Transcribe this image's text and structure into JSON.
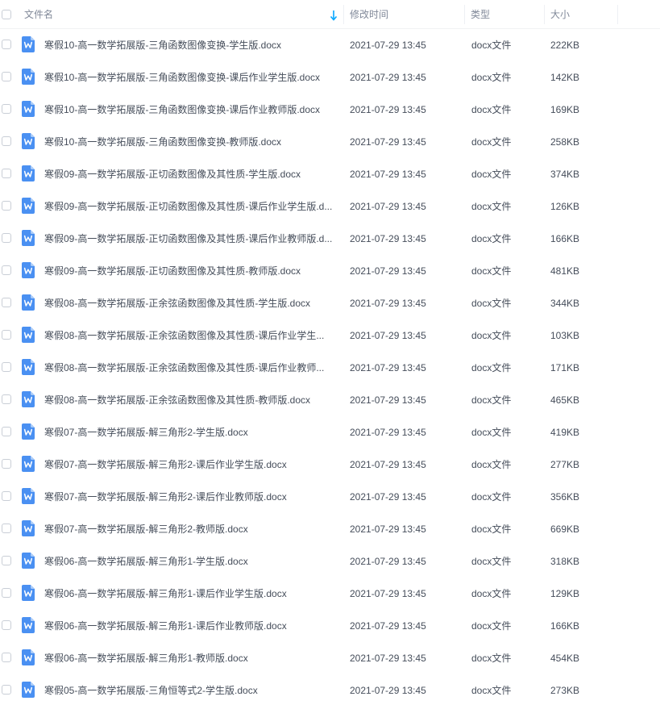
{
  "header": {
    "name_label": "文件名",
    "time_label": "修改时间",
    "type_label": "类型",
    "size_label": "大小"
  },
  "colors": {
    "accent": "#06a7ff",
    "doc_icon": "#4a90f2",
    "text": "#454d5a",
    "header_text": "#818999"
  },
  "icons": {
    "file": "word-doc-icon",
    "sort": "arrow-down-icon"
  },
  "files": [
    {
      "name": "寒假10-高一数学拓展版-三角函数图像变换-学生版.docx",
      "time": "2021-07-29 13:45",
      "type": "docx文件",
      "size": "222KB"
    },
    {
      "name": "寒假10-高一数学拓展版-三角函数图像变换-课后作业学生版.docx",
      "time": "2021-07-29 13:45",
      "type": "docx文件",
      "size": "142KB"
    },
    {
      "name": "寒假10-高一数学拓展版-三角函数图像变换-课后作业教师版.docx",
      "time": "2021-07-29 13:45",
      "type": "docx文件",
      "size": "169KB"
    },
    {
      "name": "寒假10-高一数学拓展版-三角函数图像变换-教师版.docx",
      "time": "2021-07-29 13:45",
      "type": "docx文件",
      "size": "258KB"
    },
    {
      "name": "寒假09-高一数学拓展版-正切函数图像及其性质-学生版.docx",
      "time": "2021-07-29 13:45",
      "type": "docx文件",
      "size": "374KB"
    },
    {
      "name": "寒假09-高一数学拓展版-正切函数图像及其性质-课后作业学生版.d...",
      "time": "2021-07-29 13:45",
      "type": "docx文件",
      "size": "126KB"
    },
    {
      "name": "寒假09-高一数学拓展版-正切函数图像及其性质-课后作业教师版.d...",
      "time": "2021-07-29 13:45",
      "type": "docx文件",
      "size": "166KB"
    },
    {
      "name": "寒假09-高一数学拓展版-正切函数图像及其性质-教师版.docx",
      "time": "2021-07-29 13:45",
      "type": "docx文件",
      "size": "481KB"
    },
    {
      "name": "寒假08-高一数学拓展版-正余弦函数图像及其性质-学生版.docx",
      "time": "2021-07-29 13:45",
      "type": "docx文件",
      "size": "344KB"
    },
    {
      "name": "寒假08-高一数学拓展版-正余弦函数图像及其性质-课后作业学生...",
      "time": "2021-07-29 13:45",
      "type": "docx文件",
      "size": "103KB"
    },
    {
      "name": "寒假08-高一数学拓展版-正余弦函数图像及其性质-课后作业教师...",
      "time": "2021-07-29 13:45",
      "type": "docx文件",
      "size": "171KB"
    },
    {
      "name": "寒假08-高一数学拓展版-正余弦函数图像及其性质-教师版.docx",
      "time": "2021-07-29 13:45",
      "type": "docx文件",
      "size": "465KB"
    },
    {
      "name": "寒假07-高一数学拓展版-解三角形2-学生版.docx",
      "time": "2021-07-29 13:45",
      "type": "docx文件",
      "size": "419KB"
    },
    {
      "name": "寒假07-高一数学拓展版-解三角形2-课后作业学生版.docx",
      "time": "2021-07-29 13:45",
      "type": "docx文件",
      "size": "277KB"
    },
    {
      "name": "寒假07-高一数学拓展版-解三角形2-课后作业教师版.docx",
      "time": "2021-07-29 13:45",
      "type": "docx文件",
      "size": "356KB"
    },
    {
      "name": "寒假07-高一数学拓展版-解三角形2-教师版.docx",
      "time": "2021-07-29 13:45",
      "type": "docx文件",
      "size": "669KB"
    },
    {
      "name": "寒假06-高一数学拓展版-解三角形1-学生版.docx",
      "time": "2021-07-29 13:45",
      "type": "docx文件",
      "size": "318KB"
    },
    {
      "name": "寒假06-高一数学拓展版-解三角形1-课后作业学生版.docx",
      "time": "2021-07-29 13:45",
      "type": "docx文件",
      "size": "129KB"
    },
    {
      "name": "寒假06-高一数学拓展版-解三角形1-课后作业教师版.docx",
      "time": "2021-07-29 13:45",
      "type": "docx文件",
      "size": "166KB"
    },
    {
      "name": "寒假06-高一数学拓展版-解三角形1-教师版.docx",
      "time": "2021-07-29 13:45",
      "type": "docx文件",
      "size": "454KB"
    },
    {
      "name": "寒假05-高一数学拓展版-三角恒等式2-学生版.docx",
      "time": "2021-07-29 13:45",
      "type": "docx文件",
      "size": "273KB"
    }
  ]
}
